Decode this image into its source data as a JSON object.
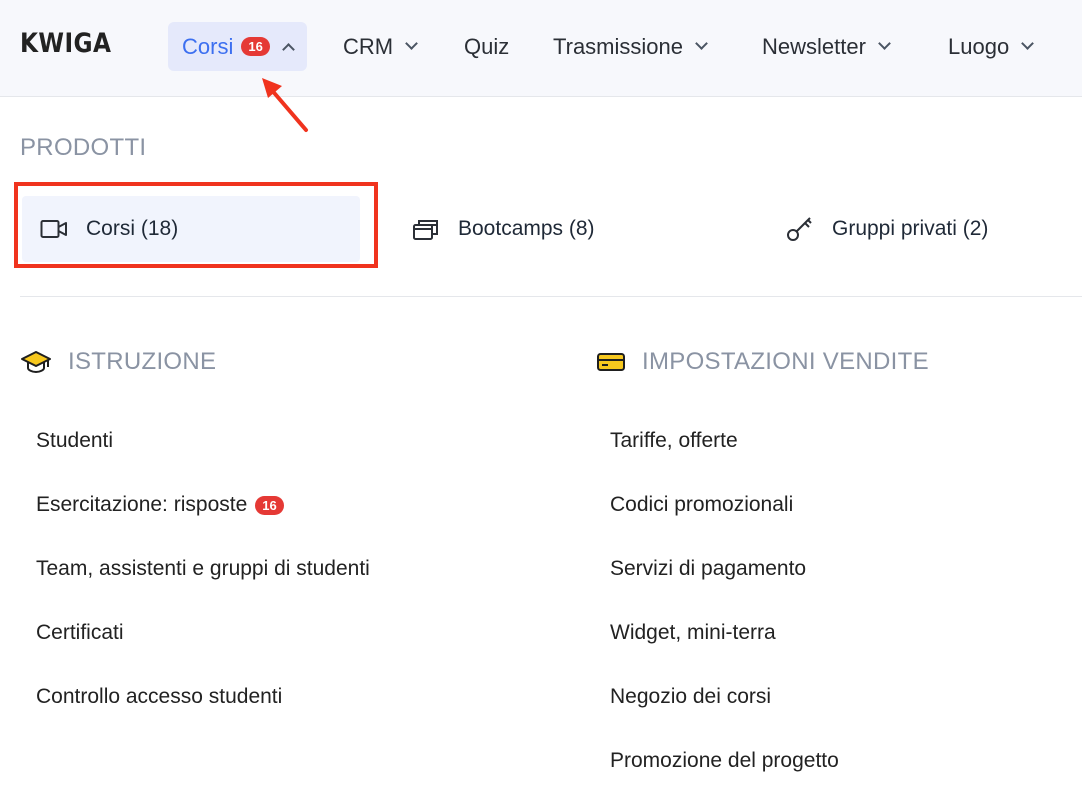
{
  "logo": "KWIGA",
  "nav": {
    "items": [
      {
        "label": "Corsi",
        "badge": "16"
      },
      {
        "label": "CRM"
      },
      {
        "label": "Quiz"
      },
      {
        "label": "Trasmissione"
      },
      {
        "label": "Newsletter"
      },
      {
        "label": "Luogo"
      }
    ]
  },
  "products": {
    "title": "PRODOTTI",
    "items": [
      {
        "label": "Corsi (18)",
        "icon": "video-camera-icon"
      },
      {
        "label": "Bootcamps (8)",
        "icon": "stacked-windows-icon"
      },
      {
        "label": "Gruppi privati (2)",
        "icon": "key-icon"
      }
    ]
  },
  "education": {
    "title": "ISTRUZIONE",
    "icon": "graduation-cap-icon",
    "links": [
      {
        "label": "Studenti"
      },
      {
        "label": "Esercitazione: risposte",
        "badge": "16"
      },
      {
        "label": "Team, assistenti e gruppi di studenti"
      },
      {
        "label": "Certificati"
      },
      {
        "label": "Controllo accesso studenti"
      }
    ]
  },
  "sales": {
    "title": "IMPOSTAZIONI VENDITE",
    "icon": "credit-card-icon",
    "links": [
      {
        "label": "Tariffe, offerte"
      },
      {
        "label": "Codici promozionali"
      },
      {
        "label": "Servizi di pagamento"
      },
      {
        "label": "Widget, mini-terra"
      },
      {
        "label": "Negozio dei corsi"
      },
      {
        "label": "Promozione del progetto"
      }
    ]
  },
  "colors": {
    "accent": "#3c6ff0",
    "badge": "#e53935",
    "annotation": "#f0331e",
    "muted": "#8a93a3"
  }
}
